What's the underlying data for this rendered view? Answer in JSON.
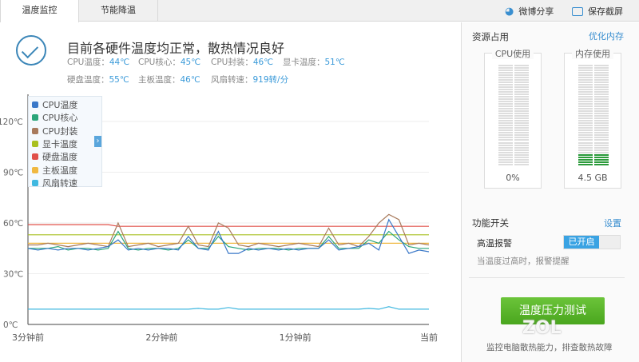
{
  "tabs": [
    {
      "label": "温度监控",
      "active": true
    },
    {
      "label": "节能降温",
      "active": false
    }
  ],
  "toolbar": {
    "share": "微博分享",
    "screenshot": "保存截屏"
  },
  "status": {
    "headline": "目前各硬件温度均正常，散热情况良好",
    "items": [
      {
        "label": "CPU温度：",
        "value": "44℃"
      },
      {
        "label": "CPU核心：",
        "value": "45℃"
      },
      {
        "label": "CPU封装：",
        "value": "46℃"
      },
      {
        "label": "显卡温度：",
        "value": "51℃"
      },
      {
        "label": "硬盘温度：",
        "value": "55℃"
      },
      {
        "label": "主板温度：",
        "value": "46℃"
      },
      {
        "label": "风扇转速：",
        "value": "919转/分"
      }
    ]
  },
  "resources": {
    "title": "资源占用",
    "optimize": "优化内存",
    "cpu": {
      "label": "CPU使用",
      "value": "0%",
      "fraction": 0
    },
    "memory": {
      "label": "内存使用",
      "value": "4.5 GB",
      "fraction": 0.13
    }
  },
  "features": {
    "title": "功能开关",
    "settings": "设置",
    "alarm_label": "高温报警",
    "alarm_state": "已开启",
    "alarm_desc": "当温度过高时，报警提醒"
  },
  "stress": {
    "button": "温度压力测试",
    "desc": "监控电脑散热能力，排查散热故障"
  },
  "watermark": "ZOL",
  "chart_data": {
    "type": "line",
    "title": "",
    "xlabel": "",
    "ylabel": "",
    "x": [
      -180,
      -175.5,
      -171,
      -166.5,
      -162,
      -157.5,
      -153,
      -148.5,
      -144,
      -139.5,
      -135,
      -130.5,
      -126,
      -121.5,
      -117,
      -112.5,
      -108,
      -103.5,
      -99,
      -94.5,
      -90,
      -85.5,
      -81,
      -76.5,
      -72,
      -67.5,
      -63,
      -58.5,
      -54,
      -49.5,
      -45,
      -40.5,
      -36,
      -31.5,
      -27,
      -22.5,
      -18,
      -13.5,
      -9,
      -4.5,
      0
    ],
    "xticks": [
      {
        "t": -180,
        "label": "3分钟前"
      },
      {
        "t": -120,
        "label": "2分钟前"
      },
      {
        "t": -60,
        "label": "1分钟前"
      },
      {
        "t": 0,
        "label": "当前"
      }
    ],
    "yticks": [
      {
        "v": 120,
        "label": "120℃"
      },
      {
        "v": 90,
        "label": "90℃"
      },
      {
        "v": 60,
        "label": "60℃"
      },
      {
        "v": 30,
        "label": "30℃"
      },
      {
        "v": 0,
        "label": "0℃"
      }
    ],
    "ylim": [
      0,
      120
    ],
    "legend_position": "top-left",
    "series": [
      {
        "name": "CPU温度",
        "color": "#3a78c8",
        "values": [
          45,
          44,
          45,
          44,
          45,
          45,
          44,
          45,
          46,
          50,
          44,
          45,
          44,
          45,
          45,
          44,
          52,
          45,
          44,
          55,
          42,
          42,
          45,
          44,
          45,
          44,
          45,
          44,
          45,
          45,
          50,
          44,
          45,
          46,
          48,
          44,
          62,
          52,
          42,
          44,
          43
        ]
      },
      {
        "name": "CPU核心",
        "color": "#2aa57a",
        "values": [
          45,
          45,
          45,
          46,
          44,
          45,
          45,
          44,
          45,
          55,
          45,
          44,
          45,
          45,
          44,
          45,
          50,
          45,
          45,
          52,
          46,
          45,
          44,
          45,
          45,
          45,
          44,
          45,
          45,
          45,
          52,
          45,
          45,
          45,
          50,
          48,
          55,
          50,
          46,
          45,
          45
        ]
      },
      {
        "name": "CPU封装",
        "color": "#a87a5c",
        "values": [
          47,
          47,
          48,
          47,
          46,
          47,
          48,
          47,
          46,
          60,
          46,
          47,
          48,
          46,
          47,
          48,
          58,
          47,
          46,
          60,
          57,
          47,
          46,
          48,
          47,
          46,
          47,
          48,
          47,
          46,
          57,
          47,
          48,
          46,
          52,
          60,
          65,
          62,
          47,
          48,
          47
        ]
      },
      {
        "name": "显卡温度",
        "color": "#a8c020",
        "values": [
          53,
          53,
          53,
          53,
          53,
          53,
          53,
          53,
          53,
          53,
          53,
          53,
          53,
          53,
          53,
          53,
          53,
          53,
          53,
          53,
          53,
          53,
          53,
          53,
          53,
          53,
          53,
          53,
          53,
          53,
          53,
          53,
          53,
          53,
          53,
          53,
          53,
          53,
          53,
          53,
          53
        ]
      },
      {
        "name": "硬盘温度",
        "color": "#e0504a",
        "values": [
          59,
          59,
          59,
          59,
          59,
          59,
          59,
          59,
          59,
          58,
          58,
          58,
          58,
          58,
          58,
          58,
          58,
          58,
          58,
          58,
          58,
          58,
          58,
          58,
          58,
          58,
          58,
          58,
          58,
          58,
          58,
          58,
          58,
          58,
          58,
          58,
          58,
          58,
          58,
          58,
          58
        ]
      },
      {
        "name": "主板温度",
        "color": "#f0b840",
        "values": [
          48,
          48,
          48,
          48,
          48,
          48,
          48,
          48,
          48,
          48,
          48,
          48,
          48,
          48,
          48,
          48,
          48,
          48,
          48,
          48,
          48,
          48,
          48,
          48,
          48,
          48,
          48,
          48,
          48,
          48,
          48,
          48,
          48,
          48,
          48,
          48,
          48,
          48,
          48,
          48,
          48
        ]
      },
      {
        "name": "风扇转速",
        "color": "#40b8e0",
        "values": [
          9,
          9,
          9,
          9,
          9,
          9,
          9,
          9,
          9,
          9,
          9,
          9,
          9,
          9,
          9,
          9,
          9,
          9.5,
          9,
          9,
          10,
          9,
          9,
          9,
          9,
          9,
          9,
          9,
          9,
          9,
          9,
          9,
          9,
          9,
          9.5,
          9,
          10.5,
          9,
          9,
          9,
          9
        ]
      }
    ]
  }
}
